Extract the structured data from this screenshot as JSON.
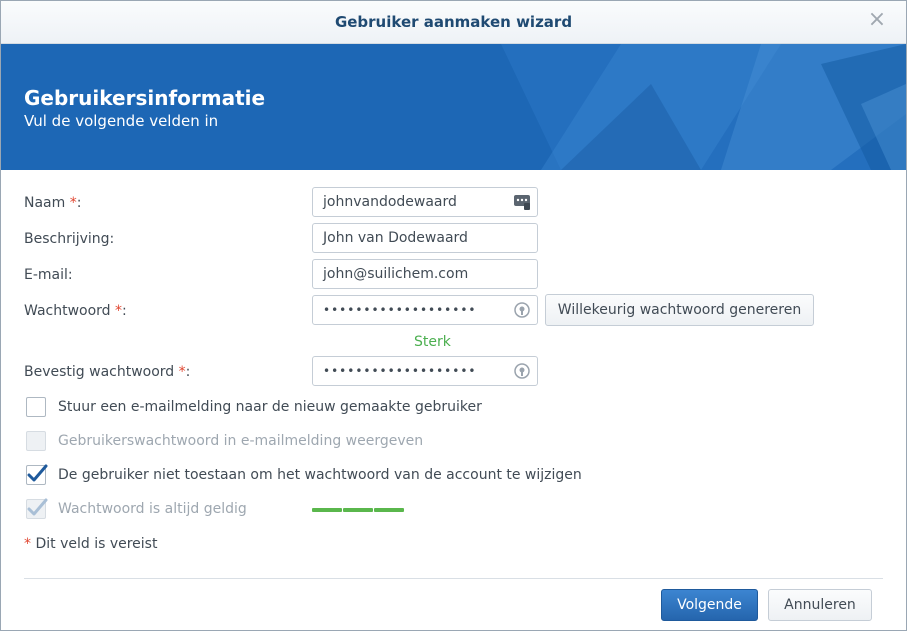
{
  "window": {
    "title": "Gebruiker aanmaken wizard",
    "close_glyph": "×"
  },
  "banner": {
    "title": "Gebruikersinformatie",
    "subtitle": "Vul de volgende velden in"
  },
  "form": {
    "required_mark": "*",
    "name": {
      "label": "Naam",
      "value": "johnvandodewaard",
      "required": true
    },
    "description": {
      "label": "Beschrijving:",
      "value": "John van Dodewaard"
    },
    "email": {
      "label": "E-mail:",
      "value": "john@suilichem.com"
    },
    "password": {
      "label": "Wachtwoord",
      "value": "•••••••••••••••••••",
      "required": true
    },
    "generate_button": "Willekeurig wachtwoord genereren",
    "strength": {
      "label": "Sterk",
      "color": "#5ab74c",
      "level": 1.0
    },
    "confirm": {
      "label": "Bevestig wachtwoord",
      "value": "•••••••••••••••••••",
      "required": true
    },
    "checkboxes": [
      {
        "label": "Stuur een e-mailmelding naar de nieuw gemaakte gebruiker",
        "checked": false,
        "disabled": false
      },
      {
        "label": "Gebruikerswachtwoord in e-mailmelding weergeven",
        "checked": false,
        "disabled": true
      },
      {
        "label": "De gebruiker niet toestaan om het wachtwoord van de account te wijzigen",
        "checked": true,
        "disabled": false
      },
      {
        "label": "Wachtwoord is altijd geldig",
        "checked": true,
        "disabled": true
      }
    ],
    "footnote": "Dit veld is vereist"
  },
  "footer": {
    "next": "Volgende",
    "cancel": "Annuleren"
  },
  "colors": {
    "accent": "#1d67b5",
    "required": "#e0452f",
    "strength": "#4caf50"
  }
}
